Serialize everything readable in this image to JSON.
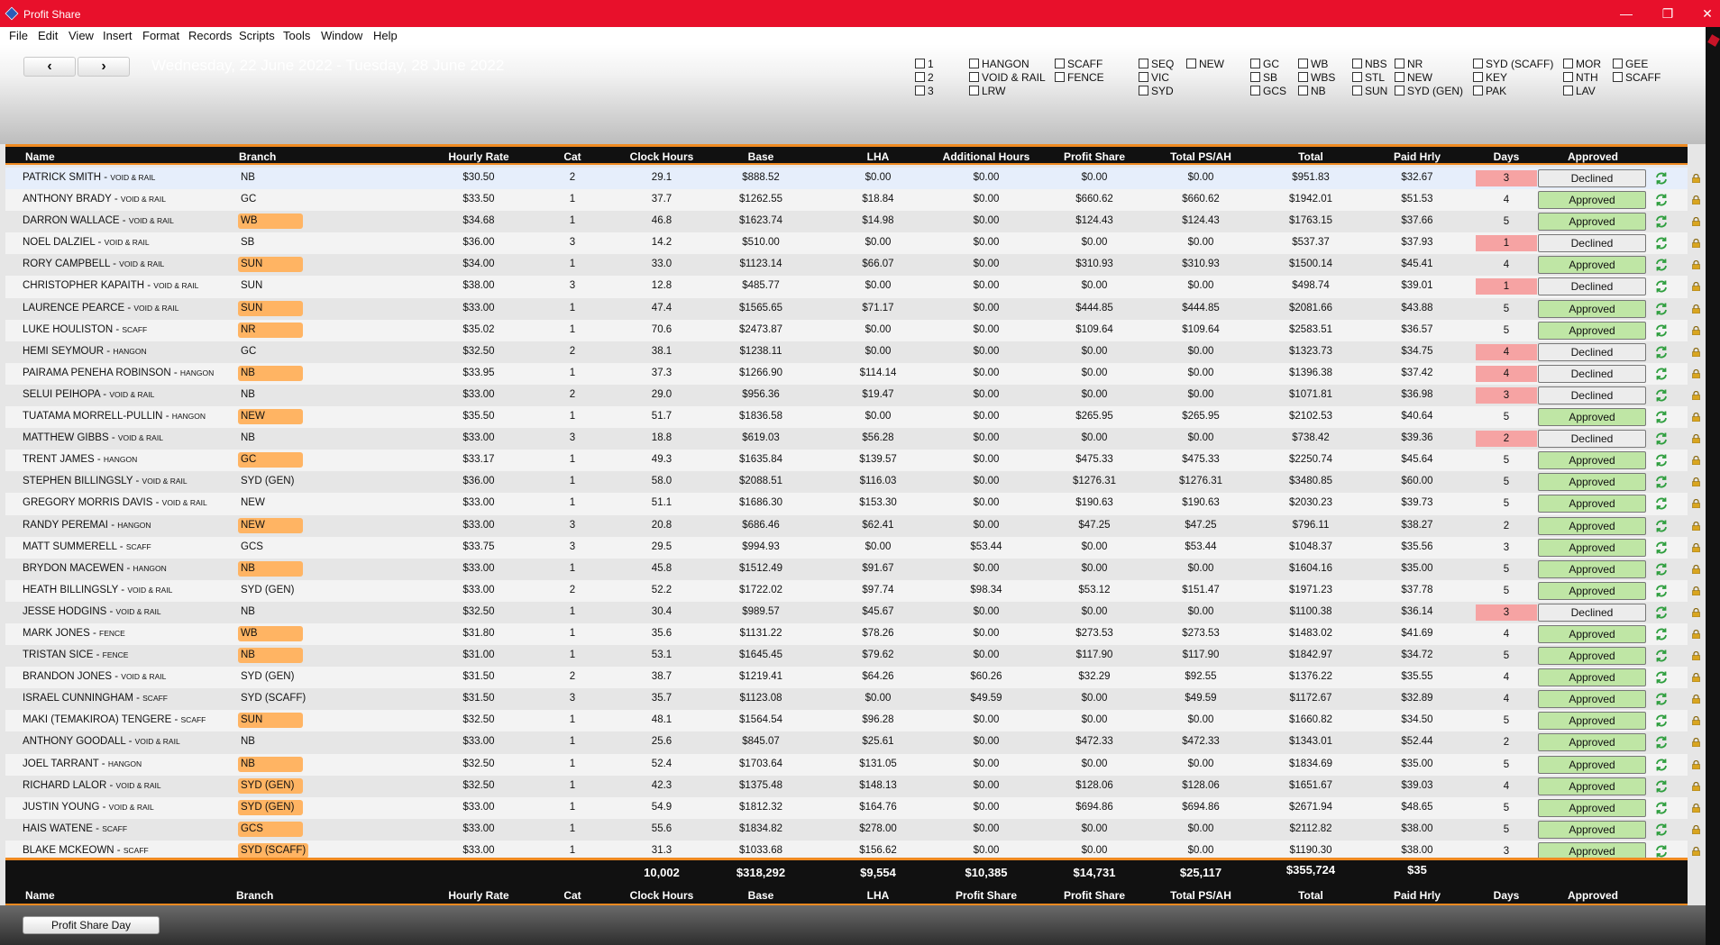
{
  "window": {
    "title": "Profit Share",
    "minimize": "—",
    "maximize": "❐",
    "close": "✕"
  },
  "menu": [
    "File",
    "Edit",
    "View",
    "Insert",
    "Format",
    "Records",
    "Scripts",
    "Tools",
    "Window",
    "Help"
  ],
  "nav": {
    "prev": "‹",
    "next": "›",
    "date_range": "Wednesday, 22 June 2022 - Tuesday, 28 June 2022"
  },
  "filters": [
    [
      "1",
      "2",
      "3"
    ],
    [
      "HANGON",
      "VOID & RAIL",
      "LRW"
    ],
    [
      "SCAFF",
      "FENCE"
    ],
    [
      "SEQ",
      "VIC",
      "SYD"
    ],
    [
      "NEW"
    ],
    [
      "GC",
      "SB",
      "GCS"
    ],
    [
      "WB",
      "WBS",
      "NB"
    ],
    [
      "NBS",
      "STL",
      "SUN"
    ],
    [
      "NR",
      "NEW",
      "SYD (GEN)"
    ],
    [
      "SYD (SCAFF)",
      "KEY",
      "PAK"
    ],
    [
      "MOR",
      "NTH",
      "LAV"
    ],
    [
      "GEE",
      "SCAFF"
    ]
  ],
  "columns": {
    "name": "Name",
    "branch": "Branch",
    "rate": "Hourly Rate",
    "cat": "Cat",
    "clock": "Clock Hours",
    "base": "Base",
    "lha": "LHA",
    "add": "Additional Hours",
    "ps": "Profit Share",
    "tps": "Total PS/AH",
    "total": "Total",
    "hrly": "Paid Hrly",
    "days": "Days",
    "appr": "Approved"
  },
  "rows": [
    {
      "name": "PATRICK SMITH",
      "type": "VOID & RAIL",
      "branch": "NB",
      "hl": false,
      "rate": "$30.50",
      "cat": "2",
      "clock": "29.1",
      "base": "$888.52",
      "lha": "$0.00",
      "add": "$0.00",
      "ps": "$0.00",
      "tps": "$0.00",
      "total": "$951.83",
      "hrly": "$32.67",
      "days": "3",
      "days_red": true,
      "status": "Declined"
    },
    {
      "name": "ANTHONY BRADY",
      "type": "VOID & RAIL",
      "branch": "GC",
      "hl": false,
      "rate": "$33.50",
      "cat": "1",
      "clock": "37.7",
      "base": "$1262.55",
      "lha": "$18.84",
      "add": "$0.00",
      "ps": "$660.62",
      "tps": "$660.62",
      "total": "$1942.01",
      "hrly": "$51.53",
      "days": "4",
      "days_red": false,
      "status": "Approved"
    },
    {
      "name": "DARRON WALLACE",
      "type": "VOID & RAIL",
      "branch": "WB",
      "hl": true,
      "rate": "$34.68",
      "cat": "1",
      "clock": "46.8",
      "base": "$1623.74",
      "lha": "$14.98",
      "add": "$0.00",
      "ps": "$124.43",
      "tps": "$124.43",
      "total": "$1763.15",
      "hrly": "$37.66",
      "days": "5",
      "days_red": false,
      "status": "Approved"
    },
    {
      "name": "NOEL DALZIEL",
      "type": "VOID & RAIL",
      "branch": "SB",
      "hl": false,
      "rate": "$36.00",
      "cat": "3",
      "clock": "14.2",
      "base": "$510.00",
      "lha": "$0.00",
      "add": "$0.00",
      "ps": "$0.00",
      "tps": "$0.00",
      "total": "$537.37",
      "hrly": "$37.93",
      "days": "1",
      "days_red": true,
      "status": "Declined"
    },
    {
      "name": "RORY CAMPBELL",
      "type": "VOID & RAIL",
      "branch": "SUN",
      "hl": true,
      "rate": "$34.00",
      "cat": "1",
      "clock": "33.0",
      "base": "$1123.14",
      "lha": "$66.07",
      "add": "$0.00",
      "ps": "$310.93",
      "tps": "$310.93",
      "total": "$1500.14",
      "hrly": "$45.41",
      "days": "4",
      "days_red": false,
      "status": "Approved"
    },
    {
      "name": "CHRISTOPHER KAPAITH",
      "type": "VOID & RAIL",
      "branch": "SUN",
      "hl": false,
      "rate": "$38.00",
      "cat": "3",
      "clock": "12.8",
      "base": "$485.77",
      "lha": "$0.00",
      "add": "$0.00",
      "ps": "$0.00",
      "tps": "$0.00",
      "total": "$498.74",
      "hrly": "$39.01",
      "days": "1",
      "days_red": true,
      "status": "Declined"
    },
    {
      "name": "LAURENCE PEARCE",
      "type": "VOID & RAIL",
      "branch": "SUN",
      "hl": true,
      "rate": "$33.00",
      "cat": "1",
      "clock": "47.4",
      "base": "$1565.65",
      "lha": "$71.17",
      "add": "$0.00",
      "ps": "$444.85",
      "tps": "$444.85",
      "total": "$2081.66",
      "hrly": "$43.88",
      "days": "5",
      "days_red": false,
      "status": "Approved"
    },
    {
      "name": "LUKE HOULISTON",
      "type": "SCAFF",
      "branch": "NR",
      "hl": true,
      "rate": "$35.02",
      "cat": "1",
      "clock": "70.6",
      "base": "$2473.87",
      "lha": "$0.00",
      "add": "$0.00",
      "ps": "$109.64",
      "tps": "$109.64",
      "total": "$2583.51",
      "hrly": "$36.57",
      "days": "5",
      "days_red": false,
      "status": "Approved"
    },
    {
      "name": "HEMI SEYMOUR",
      "type": "HANGON",
      "branch": "GC",
      "hl": false,
      "rate": "$32.50",
      "cat": "2",
      "clock": "38.1",
      "base": "$1238.11",
      "lha": "$0.00",
      "add": "$0.00",
      "ps": "$0.00",
      "tps": "$0.00",
      "total": "$1323.73",
      "hrly": "$34.75",
      "days": "4",
      "days_red": true,
      "status": "Declined"
    },
    {
      "name": "PAIRAMA PENEHA ROBINSON",
      "type": "HANGON",
      "branch": "NB",
      "hl": true,
      "rate": "$33.95",
      "cat": "1",
      "clock": "37.3",
      "base": "$1266.90",
      "lha": "$114.14",
      "add": "$0.00",
      "ps": "$0.00",
      "tps": "$0.00",
      "total": "$1396.38",
      "hrly": "$37.42",
      "days": "4",
      "days_red": true,
      "status": "Declined"
    },
    {
      "name": "SELUI PEIHOPA",
      "type": "VOID & RAIL",
      "branch": "NB",
      "hl": false,
      "rate": "$33.00",
      "cat": "2",
      "clock": "29.0",
      "base": "$956.36",
      "lha": "$19.47",
      "add": "$0.00",
      "ps": "$0.00",
      "tps": "$0.00",
      "total": "$1071.81",
      "hrly": "$36.98",
      "days": "3",
      "days_red": true,
      "status": "Declined"
    },
    {
      "name": "TUATAMA MORRELL-PULLIN",
      "type": "HANGON",
      "branch": "NEW",
      "hl": true,
      "rate": "$35.50",
      "cat": "1",
      "clock": "51.7",
      "base": "$1836.58",
      "lha": "$0.00",
      "add": "$0.00",
      "ps": "$265.95",
      "tps": "$265.95",
      "total": "$2102.53",
      "hrly": "$40.64",
      "days": "5",
      "days_red": false,
      "status": "Approved"
    },
    {
      "name": "MATTHEW GIBBS",
      "type": "VOID & RAIL",
      "branch": "NB",
      "hl": false,
      "rate": "$33.00",
      "cat": "3",
      "clock": "18.8",
      "base": "$619.03",
      "lha": "$56.28",
      "add": "$0.00",
      "ps": "$0.00",
      "tps": "$0.00",
      "total": "$738.42",
      "hrly": "$39.36",
      "days": "2",
      "days_red": true,
      "status": "Declined"
    },
    {
      "name": "TRENT JAMES",
      "type": "HANGON",
      "branch": "GC",
      "hl": true,
      "rate": "$33.17",
      "cat": "1",
      "clock": "49.3",
      "base": "$1635.84",
      "lha": "$139.57",
      "add": "$0.00",
      "ps": "$475.33",
      "tps": "$475.33",
      "total": "$2250.74",
      "hrly": "$45.64",
      "days": "5",
      "days_red": false,
      "status": "Approved"
    },
    {
      "name": "STEPHEN BILLINGSLY",
      "type": "VOID & RAIL",
      "branch": "SYD (GEN)",
      "hl": false,
      "rate": "$36.00",
      "cat": "1",
      "clock": "58.0",
      "base": "$2088.51",
      "lha": "$116.03",
      "add": "$0.00",
      "ps": "$1276.31",
      "tps": "$1276.31",
      "total": "$3480.85",
      "hrly": "$60.00",
      "days": "5",
      "days_red": false,
      "status": "Approved"
    },
    {
      "name": "GREGORY MORRIS DAVIS",
      "type": "VOID & RAIL",
      "branch": "NEW",
      "hl": false,
      "rate": "$33.00",
      "cat": "1",
      "clock": "51.1",
      "base": "$1686.30",
      "lha": "$153.30",
      "add": "$0.00",
      "ps": "$190.63",
      "tps": "$190.63",
      "total": "$2030.23",
      "hrly": "$39.73",
      "days": "5",
      "days_red": false,
      "status": "Approved"
    },
    {
      "name": "RANDY PEREMAI",
      "type": "HANGON",
      "branch": "NEW",
      "hl": true,
      "rate": "$33.00",
      "cat": "3",
      "clock": "20.8",
      "base": "$686.46",
      "lha": "$62.41",
      "add": "$0.00",
      "ps": "$47.25",
      "tps": "$47.25",
      "total": "$796.11",
      "hrly": "$38.27",
      "days": "2",
      "days_red": false,
      "status": "Approved"
    },
    {
      "name": "MATT SUMMERELL",
      "type": "SCAFF",
      "branch": "GCS",
      "hl": false,
      "rate": "$33.75",
      "cat": "3",
      "clock": "29.5",
      "base": "$994.93",
      "lha": "$0.00",
      "add": "$53.44",
      "ps": "$0.00",
      "tps": "$53.44",
      "total": "$1048.37",
      "hrly": "$35.56",
      "days": "3",
      "days_red": false,
      "status": "Approved"
    },
    {
      "name": "BRYDON MACEWEN",
      "type": "HANGON",
      "branch": "NB",
      "hl": true,
      "rate": "$33.00",
      "cat": "1",
      "clock": "45.8",
      "base": "$1512.49",
      "lha": "$91.67",
      "add": "$0.00",
      "ps": "$0.00",
      "tps": "$0.00",
      "total": "$1604.16",
      "hrly": "$35.00",
      "days": "5",
      "days_red": false,
      "status": "Approved"
    },
    {
      "name": "HEATH BILLINGSLY",
      "type": "VOID & RAIL",
      "branch": "SYD (GEN)",
      "hl": false,
      "rate": "$33.00",
      "cat": "2",
      "clock": "52.2",
      "base": "$1722.02",
      "lha": "$97.74",
      "add": "$98.34",
      "ps": "$53.12",
      "tps": "$151.47",
      "total": "$1971.23",
      "hrly": "$37.78",
      "days": "5",
      "days_red": false,
      "status": "Approved"
    },
    {
      "name": "JESSE HODGINS",
      "type": "VOID & RAIL",
      "branch": "NB",
      "hl": false,
      "rate": "$32.50",
      "cat": "1",
      "clock": "30.4",
      "base": "$989.57",
      "lha": "$45.67",
      "add": "$0.00",
      "ps": "$0.00",
      "tps": "$0.00",
      "total": "$1100.38",
      "hrly": "$36.14",
      "days": "3",
      "days_red": true,
      "status": "Declined"
    },
    {
      "name": "MARK JONES",
      "type": "FENCE",
      "branch": "WB",
      "hl": true,
      "rate": "$31.80",
      "cat": "1",
      "clock": "35.6",
      "base": "$1131.22",
      "lha": "$78.26",
      "add": "$0.00",
      "ps": "$273.53",
      "tps": "$273.53",
      "total": "$1483.02",
      "hrly": "$41.69",
      "days": "4",
      "days_red": false,
      "status": "Approved"
    },
    {
      "name": "TRISTAN SICE",
      "type": "FENCE",
      "branch": "NB",
      "hl": true,
      "rate": "$31.00",
      "cat": "1",
      "clock": "53.1",
      "base": "$1645.45",
      "lha": "$79.62",
      "add": "$0.00",
      "ps": "$117.90",
      "tps": "$117.90",
      "total": "$1842.97",
      "hrly": "$34.72",
      "days": "5",
      "days_red": false,
      "status": "Approved"
    },
    {
      "name": "BRANDON JONES",
      "type": "VOID & RAIL",
      "branch": "SYD (GEN)",
      "hl": false,
      "rate": "$31.50",
      "cat": "2",
      "clock": "38.7",
      "base": "$1219.41",
      "lha": "$64.26",
      "add": "$60.26",
      "ps": "$32.29",
      "tps": "$92.55",
      "total": "$1376.22",
      "hrly": "$35.55",
      "days": "4",
      "days_red": false,
      "status": "Approved"
    },
    {
      "name": "ISRAEL CUNNINGHAM",
      "type": "SCAFF",
      "branch": "SYD (SCAFF)",
      "hl": false,
      "rate": "$31.50",
      "cat": "3",
      "clock": "35.7",
      "base": "$1123.08",
      "lha": "$0.00",
      "add": "$49.59",
      "ps": "$0.00",
      "tps": "$49.59",
      "total": "$1172.67",
      "hrly": "$32.89",
      "days": "4",
      "days_red": false,
      "status": "Approved"
    },
    {
      "name": "MAKI (TEMAKIROA) TENGERE",
      "type": "SCAFF",
      "branch": "SUN",
      "hl": true,
      "rate": "$32.50",
      "cat": "1",
      "clock": "48.1",
      "base": "$1564.54",
      "lha": "$96.28",
      "add": "$0.00",
      "ps": "$0.00",
      "tps": "$0.00",
      "total": "$1660.82",
      "hrly": "$34.50",
      "days": "5",
      "days_red": false,
      "status": "Approved"
    },
    {
      "name": "ANTHONY GOODALL",
      "type": "VOID & RAIL",
      "branch": "NB",
      "hl": false,
      "rate": "$33.00",
      "cat": "1",
      "clock": "25.6",
      "base": "$845.07",
      "lha": "$25.61",
      "add": "$0.00",
      "ps": "$472.33",
      "tps": "$472.33",
      "total": "$1343.01",
      "hrly": "$52.44",
      "days": "2",
      "days_red": false,
      "status": "Approved"
    },
    {
      "name": "JOEL TARRANT",
      "type": "HANGON",
      "branch": "NB",
      "hl": true,
      "rate": "$32.50",
      "cat": "1",
      "clock": "52.4",
      "base": "$1703.64",
      "lha": "$131.05",
      "add": "$0.00",
      "ps": "$0.00",
      "tps": "$0.00",
      "total": "$1834.69",
      "hrly": "$35.00",
      "days": "5",
      "days_red": false,
      "status": "Approved"
    },
    {
      "name": "RICHARD LALOR",
      "type": "VOID & RAIL",
      "branch": "SYD (GEN)",
      "hl": true,
      "rate": "$32.50",
      "cat": "1",
      "clock": "42.3",
      "base": "$1375.48",
      "lha": "$148.13",
      "add": "$0.00",
      "ps": "$128.06",
      "tps": "$128.06",
      "total": "$1651.67",
      "hrly": "$39.03",
      "days": "4",
      "days_red": false,
      "status": "Approved"
    },
    {
      "name": "JUSTIN YOUNG",
      "type": "VOID & RAIL",
      "branch": "SYD (GEN)",
      "hl": true,
      "rate": "$33.00",
      "cat": "1",
      "clock": "54.9",
      "base": "$1812.32",
      "lha": "$164.76",
      "add": "$0.00",
      "ps": "$694.86",
      "tps": "$694.86",
      "total": "$2671.94",
      "hrly": "$48.65",
      "days": "5",
      "days_red": false,
      "status": "Approved"
    },
    {
      "name": "HAIS WATENE",
      "type": "SCAFF",
      "branch": "GCS",
      "hl": true,
      "rate": "$33.00",
      "cat": "1",
      "clock": "55.6",
      "base": "$1834.82",
      "lha": "$278.00",
      "add": "$0.00",
      "ps": "$0.00",
      "tps": "$0.00",
      "total": "$2112.82",
      "hrly": "$38.00",
      "days": "5",
      "days_red": false,
      "status": "Approved"
    },
    {
      "name": "BLAKE MCKEOWN",
      "type": "SCAFF",
      "branch": "SYD (SCAFF)",
      "hl": true,
      "rate": "$33.00",
      "cat": "1",
      "clock": "31.3",
      "base": "$1033.68",
      "lha": "$156.62",
      "add": "$0.00",
      "ps": "$0.00",
      "tps": "$0.00",
      "total": "$1190.30",
      "hrly": "$38.00",
      "days": "3",
      "days_red": false,
      "status": "Approved"
    }
  ],
  "totals": {
    "clock": "10,002",
    "base": "$318,292",
    "lha": "$9,554",
    "add": "$10,385",
    "ps": "$14,731",
    "tps": "$25,117",
    "total": "$355,724",
    "hrly": "$35"
  },
  "footer_labels": {
    "name": "Name",
    "branch": "Branch",
    "rate": "Hourly Rate",
    "cat": "Cat",
    "clock": "Clock Hours",
    "base": "Base",
    "lha": "LHA",
    "add": "Profit Share",
    "ps": "Profit Share",
    "tps": "Total PS/AH",
    "total": "Total",
    "hrly": "Paid Hrly",
    "days": "Days",
    "appr": "Approved"
  },
  "bottom": {
    "profit_share_day": "Profit Share Day"
  },
  "colors": {
    "titlebar": "#e8102b",
    "accent_line": "#ef8a21",
    "branch_highlight": "#ffb463",
    "approved": "#bfe6a5",
    "days_alert": "#f6a3a3",
    "refresh": "#2e9e3e"
  },
  "icons": {
    "refresh": "refresh-icon",
    "lock": "lock-icon"
  }
}
